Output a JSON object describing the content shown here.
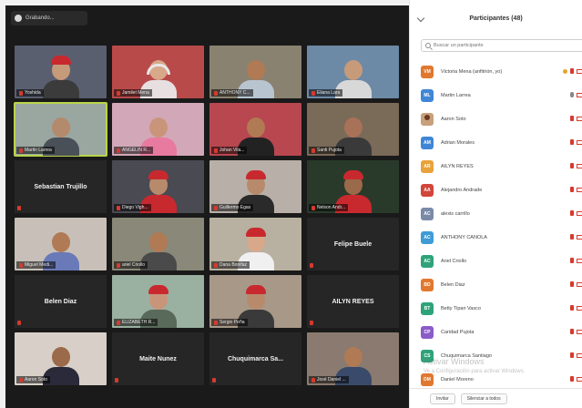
{
  "status": {
    "label": "Grabando..."
  },
  "panel": {
    "title": "Participantes (48)",
    "search_placeholder": "Buscar un participante",
    "participants": [
      {
        "initials": "VM",
        "name": "Victoria Mena (anfitrión, yo)",
        "color": "#e0782f"
      },
      {
        "initials": "ML",
        "name": "Martin Larrea",
        "color": "#3f86d6"
      },
      {
        "initials": "",
        "name": "Aaron Soto",
        "color": "#c8a07c"
      },
      {
        "initials": "AM",
        "name": "Adrian Morales",
        "color": "#3f86d6"
      },
      {
        "initials": "AR",
        "name": "AILYN REYES",
        "color": "#e8a23a"
      },
      {
        "initials": "AA",
        "name": "Alejandro Andrade",
        "color": "#d2453a"
      },
      {
        "initials": "AC",
        "name": "alexis carrillo",
        "color": "#7a8aa8"
      },
      {
        "initials": "AC",
        "name": "ANTHONY CAÑOLA",
        "color": "#3f9bd6"
      },
      {
        "initials": "AC",
        "name": "Ariel Criollo",
        "color": "#2ea37a"
      },
      {
        "initials": "BD",
        "name": "Belen Diaz",
        "color": "#e0782f"
      },
      {
        "initials": "BT",
        "name": "Betty Tipan Vasco",
        "color": "#2ea37a"
      },
      {
        "initials": "CP",
        "name": "Caridad Pujota",
        "color": "#8b5cc8"
      },
      {
        "initials": "CS",
        "name": "Chuquimarca Santiago",
        "color": "#2ea37a"
      },
      {
        "initials": "DM",
        "name": "Daniel Moreno",
        "color": "#e0782f"
      }
    ],
    "footer": {
      "invite": "Invitar",
      "mute_all": "Silenciar a todos"
    }
  },
  "tiles": [
    {
      "type": "video",
      "label": "Yoshida",
      "bg": "#5a5f70",
      "skin": "#c79a7a",
      "shirt": "#3b3b3b",
      "accessory": "hat"
    },
    {
      "type": "video",
      "label": "Jamilet Mena",
      "bg": "#b84a4a",
      "skin": "#d7a88a",
      "shirt": "#e8e0e0",
      "accessory": "headset"
    },
    {
      "type": "video",
      "label": "ANTHONY C...",
      "bg": "#8a8270",
      "skin": "#b07a55",
      "shirt": "#b8c4d0",
      "accessory": ""
    },
    {
      "type": "video",
      "label": "Eliana Lara",
      "bg": "#6c8aa6",
      "skin": "#c79a7a",
      "shirt": "#d8d8d8",
      "accessory": ""
    },
    {
      "type": "video",
      "label": "Martin Larrea",
      "bg": "#9aa6a0",
      "skin": "#b48a6c",
      "shirt": "#4a5058",
      "accessory": "",
      "active": true
    },
    {
      "type": "video",
      "label": "ANGELIN R...",
      "bg": "#d2a8b8",
      "skin": "#c9957a",
      "shirt": "#e87aa0",
      "accessory": ""
    },
    {
      "type": "video",
      "label": "Johan Vila...",
      "bg": "#b8474f",
      "skin": "#b07a55",
      "shirt": "#222222",
      "accessory": ""
    },
    {
      "type": "video",
      "label": "Santi Pujota",
      "bg": "#7a6a58",
      "skin": "#a87258",
      "shirt": "#3a3a3a",
      "accessory": ""
    },
    {
      "type": "name",
      "label": "Sebastian Trujillo"
    },
    {
      "type": "video",
      "label": "Diego Vigh...",
      "bg": "#4a4a52",
      "skin": "#b88a6c",
      "shirt": "#c8292f",
      "accessory": "hat"
    },
    {
      "type": "video",
      "label": "Guillermo Egas",
      "bg": "#b8b0a8",
      "skin": "#b88a6c",
      "shirt": "#2a2a2a",
      "accessory": "hat"
    },
    {
      "type": "video",
      "label": "Nelson Andr...",
      "bg": "#2a3a2a",
      "skin": "#9a6a4a",
      "shirt": "#c8292f",
      "accessory": "hat"
    },
    {
      "type": "video",
      "label": "Miguel Medi...",
      "bg": "#c8c0b8",
      "skin": "#b07a55",
      "shirt": "#6a7ab8",
      "accessory": ""
    },
    {
      "type": "video",
      "label": "ariel Criollo",
      "bg": "#8a8878",
      "skin": "#b07a55",
      "shirt": "#4a4a4a",
      "accessory": ""
    },
    {
      "type": "video",
      "label": "Dana Bonifaz",
      "bg": "#b8b0a0",
      "skin": "#d7a88a",
      "shirt": "#f0f0f0",
      "accessory": "hat"
    },
    {
      "type": "name",
      "label": "Felipe Buele"
    },
    {
      "type": "name",
      "label": "Belen Diaz"
    },
    {
      "type": "video",
      "label": "ELIZABETH R...",
      "bg": "#9ab0a0",
      "skin": "#c9957a",
      "shirt": "#5a6a5a",
      "accessory": "hat"
    },
    {
      "type": "video",
      "label": "Sergio Peña",
      "bg": "#a89888",
      "skin": "#b88a6c",
      "shirt": "#3a3a3a",
      "accessory": "hat"
    },
    {
      "type": "name",
      "label": "AILYN REYES"
    },
    {
      "type": "video",
      "label": "Aaron Soto",
      "bg": "#d8d0c8",
      "skin": "#9a6a4a",
      "shirt": "#2a2a3a",
      "accessory": ""
    },
    {
      "type": "name",
      "label": "Maite Nunez"
    },
    {
      "type": "name",
      "label": "Chuquimarca Sa..."
    },
    {
      "type": "video",
      "label": "José Daniel ...",
      "bg": "#8a7a70",
      "skin": "#b07a55",
      "shirt": "#3a4a6a",
      "accessory": ""
    }
  ],
  "watermark": {
    "title": "Activar Windows",
    "sub": "Ve a Configuración para activar Windows."
  }
}
